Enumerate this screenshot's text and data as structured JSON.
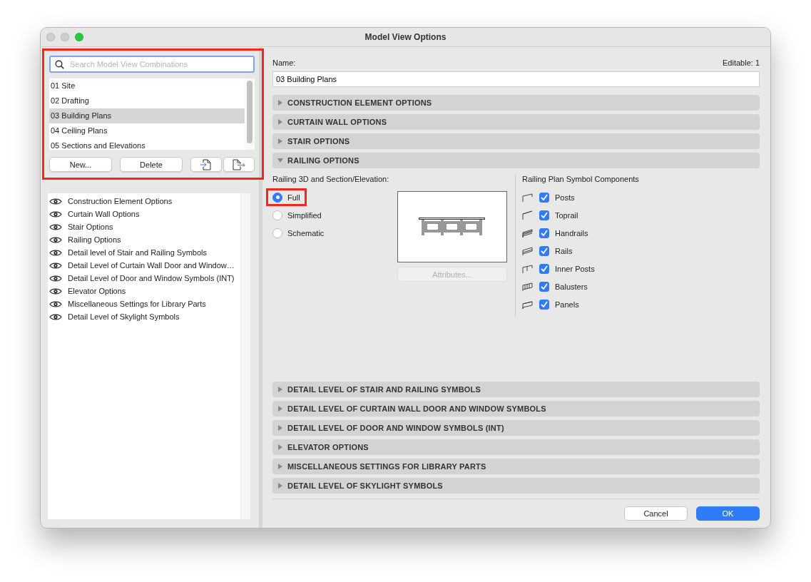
{
  "window": {
    "title": "Model View Options"
  },
  "combinations": {
    "highlighted": true,
    "search": {
      "placeholder": "Search Model View Combinations"
    },
    "items": [
      {
        "label": "01 Site",
        "selected": false
      },
      {
        "label": "02 Drafting",
        "selected": false
      },
      {
        "label": "03 Building Plans",
        "selected": true
      },
      {
        "label": "04 Ceiling Plans",
        "selected": false
      },
      {
        "label": "05 Sections and Elevations",
        "selected": false
      }
    ],
    "buttons": [
      "New...",
      "Delete"
    ]
  },
  "option_sets": [
    {
      "label": "Construction Element Options",
      "visible": true
    },
    {
      "label": "Curtain Wall Options",
      "visible": true
    },
    {
      "label": "Stair Options",
      "visible": true
    },
    {
      "label": "Railing Options",
      "visible": true
    },
    {
      "label": "Detail level of Stair and Railing Symbols",
      "visible": true
    },
    {
      "label": "Detail Level of Curtain Wall Door and Window…",
      "visible": true
    },
    {
      "label": "Detail Level of Door and Window Symbols (INT)",
      "visible": true
    },
    {
      "label": "Elevator Options",
      "visible": true
    },
    {
      "label": "Miscellaneous Settings for Library Parts",
      "visible": true
    },
    {
      "label": "Detail Level of Skylight Symbols",
      "visible": true
    }
  ],
  "name": {
    "label": "Name:",
    "value": "03 Building Plans",
    "editable": "Editable: 1"
  },
  "sections": [
    {
      "title": "CONSTRUCTION ELEMENT OPTIONS",
      "expanded": false
    },
    {
      "title": "CURTAIN WALL OPTIONS",
      "expanded": false
    },
    {
      "title": "STAIR OPTIONS",
      "expanded": false
    },
    {
      "title": "RAILING OPTIONS",
      "expanded": true
    },
    {
      "title": "DETAIL LEVEL OF STAIR AND RAILING SYMBOLS",
      "expanded": false
    },
    {
      "title": "DETAIL LEVEL OF CURTAIN WALL DOOR AND WINDOW SYMBOLS",
      "expanded": false
    },
    {
      "title": "DETAIL LEVEL OF DOOR AND WINDOW SYMBOLS (INT)",
      "expanded": false
    },
    {
      "title": "ELEVATOR OPTIONS",
      "expanded": false
    },
    {
      "title": "MISCELLANEOUS SETTINGS FOR LIBRARY PARTS",
      "expanded": false
    },
    {
      "title": "DETAIL LEVEL OF SKYLIGHT SYMBOLS",
      "expanded": false
    }
  ],
  "railing_options": {
    "mode_label": "Railing 3D and Section/Elevation:",
    "modes": [
      {
        "label": "Full",
        "selected": true,
        "highlighted": true
      },
      {
        "label": "Simplified",
        "selected": false,
        "highlighted": false
      },
      {
        "label": "Schematic",
        "selected": false,
        "highlighted": false
      }
    ],
    "attributes_button": {
      "label": "Attributes...",
      "disabled": true
    },
    "components_label": "Railing Plan Symbol Components",
    "components": [
      {
        "label": "Posts",
        "checked": true
      },
      {
        "label": "Toprail",
        "checked": true
      },
      {
        "label": "Handrails",
        "checked": true
      },
      {
        "label": "Rails",
        "checked": true
      },
      {
        "label": "Inner Posts",
        "checked": true
      },
      {
        "label": "Balusters",
        "checked": true
      },
      {
        "label": "Panels",
        "checked": true
      }
    ]
  },
  "footer": {
    "buttons": [
      {
        "label": "Cancel",
        "kind": "secondary"
      },
      {
        "label": "OK",
        "kind": "primary"
      }
    ]
  }
}
